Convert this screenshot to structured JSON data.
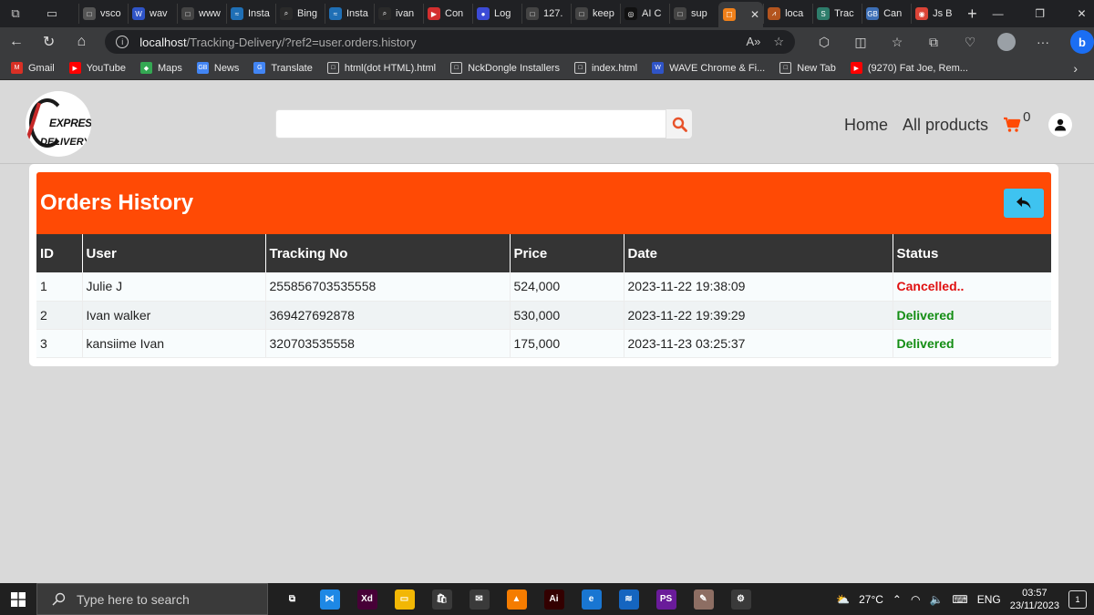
{
  "browser": {
    "tabs": [
      {
        "label": "vsco",
        "fav_color": "#555555",
        "fav_glyph": "□"
      },
      {
        "label": "wav",
        "fav_color": "#2f54c7",
        "fav_glyph": "W"
      },
      {
        "label": "www",
        "fav_color": "#444444",
        "fav_glyph": "□"
      },
      {
        "label": "Insta",
        "fav_color": "#1f6fb5",
        "fav_glyph": "≈"
      },
      {
        "label": "Bing",
        "fav_color": "#2a2a2a",
        "fav_glyph": "⌕"
      },
      {
        "label": "Insta",
        "fav_color": "#1f6fb5",
        "fav_glyph": "≈"
      },
      {
        "label": "ivan",
        "fav_color": "#2a2a2a",
        "fav_glyph": "⌕"
      },
      {
        "label": "Con",
        "fav_color": "#d32f2f",
        "fav_glyph": "▶"
      },
      {
        "label": "Log",
        "fav_color": "#3c4bd6",
        "fav_glyph": "●"
      },
      {
        "label": "127.",
        "fav_color": "#444444",
        "fav_glyph": "□"
      },
      {
        "label": "keep",
        "fav_color": "#444444",
        "fav_glyph": "□"
      },
      {
        "label": "AI C",
        "fav_color": "#111111",
        "fav_glyph": "◎"
      },
      {
        "label": "sup",
        "fav_color": "#444444",
        "fav_glyph": "□"
      },
      {
        "label": "",
        "fav_color": "#f0801a",
        "fav_glyph": "☐",
        "active": true
      },
      {
        "label": "loca",
        "fav_color": "#b3541e",
        "fav_glyph": "⩘"
      },
      {
        "label": "Trac",
        "fav_color": "#2e7d6b",
        "fav_glyph": "S"
      },
      {
        "label": "Can",
        "fav_color": "#3d6fb6",
        "fav_glyph": "GB"
      },
      {
        "label": "Js B",
        "fav_color": "#db4437",
        "fav_glyph": "◉"
      }
    ],
    "url_host": "localhost",
    "url_path": "/Tracking-Delivery/?ref2=user.orders.history",
    "bookmarks": [
      {
        "label": "Gmail",
        "fav_color": "#d93025",
        "fav_glyph": "M"
      },
      {
        "label": "YouTube",
        "fav_color": "#ff0000",
        "fav_glyph": "▶"
      },
      {
        "label": "Maps",
        "fav_color": "#34a853",
        "fav_glyph": "◆"
      },
      {
        "label": "News",
        "fav_color": "#4285f4",
        "fav_glyph": "GB"
      },
      {
        "label": "Translate",
        "fav_color": "#4285f4",
        "fav_glyph": "G"
      },
      {
        "label": "html(dot HTML).html",
        "fav_color": "#3a3b3d",
        "fav_glyph": "□"
      },
      {
        "label": "NckDongle Installers",
        "fav_color": "#3a3b3d",
        "fav_glyph": "□"
      },
      {
        "label": "index.html",
        "fav_color": "#3a3b3d",
        "fav_glyph": "□"
      },
      {
        "label": "WAVE Chrome & Fi...",
        "fav_color": "#2f54c7",
        "fav_glyph": "W"
      },
      {
        "label": "New Tab",
        "fav_color": "#3a3b3d",
        "fav_glyph": "□"
      },
      {
        "label": "(9270) Fat Joe, Rem...",
        "fav_color": "#ff0000",
        "fav_glyph": "▶"
      }
    ]
  },
  "site": {
    "logo_line1": "EXPRESS",
    "logo_line2": "DELIVERY",
    "search_placeholder": "",
    "nav_home": "Home",
    "nav_products": "All products",
    "cart_count": "0",
    "accent_color": "#ff4a05",
    "back_button_color": "#3ec3f0"
  },
  "orders": {
    "title": "Orders History",
    "columns": [
      "ID",
      "User",
      "Tracking No",
      "Price",
      "Date",
      "Status"
    ],
    "rows": [
      {
        "id": "1",
        "user": "Julie J",
        "tracking": "255856703535558",
        "price": "524,000",
        "date": "2023-11-22 19:38:09",
        "status": "Cancelled..",
        "status_kind": "cancelled"
      },
      {
        "id": "2",
        "user": "Ivan walker",
        "tracking": "369427692878",
        "price": "530,000",
        "date": "2023-11-22 19:39:29",
        "status": "Delivered",
        "status_kind": "delivered"
      },
      {
        "id": "3",
        "user": "kansiime Ivan",
        "tracking": "320703535558",
        "price": "175,000",
        "date": "2023-11-23 03:25:37",
        "status": "Delivered",
        "status_kind": "delivered"
      }
    ]
  },
  "taskbar": {
    "search_placeholder": "Type here to search",
    "weather": "27°C",
    "language": "ENG",
    "time": "03:57",
    "date": "23/11/2023",
    "notifications": "1",
    "apps": [
      {
        "name": "task-view-icon",
        "color": "#202020",
        "glyph": "⧉"
      },
      {
        "name": "vscode-icon",
        "color": "#1e88e5",
        "glyph": "⋈"
      },
      {
        "name": "adobe-xd-icon",
        "color": "#470137",
        "glyph": "Xd"
      },
      {
        "name": "file-explorer-icon",
        "color": "#f2b705",
        "glyph": "▭"
      },
      {
        "name": "store-icon",
        "color": "#3a3a3a",
        "glyph": "🛍"
      },
      {
        "name": "mail-icon",
        "color": "#3a3a3a",
        "glyph": "✉"
      },
      {
        "name": "vlc-icon",
        "color": "#f57c00",
        "glyph": "▲"
      },
      {
        "name": "illustrator-icon",
        "color": "#330000",
        "glyph": "Ai"
      },
      {
        "name": "edge-icon",
        "color": "#1976d2",
        "glyph": "e"
      },
      {
        "name": "layers-app-icon",
        "color": "#1565c0",
        "glyph": "≋"
      },
      {
        "name": "phpstorm-icon",
        "color": "#6a1b9a",
        "glyph": "PS"
      },
      {
        "name": "paint-icon",
        "color": "#8d6e63",
        "glyph": "✎"
      },
      {
        "name": "settings-icon",
        "color": "#3a3a3a",
        "glyph": "⚙"
      }
    ]
  }
}
